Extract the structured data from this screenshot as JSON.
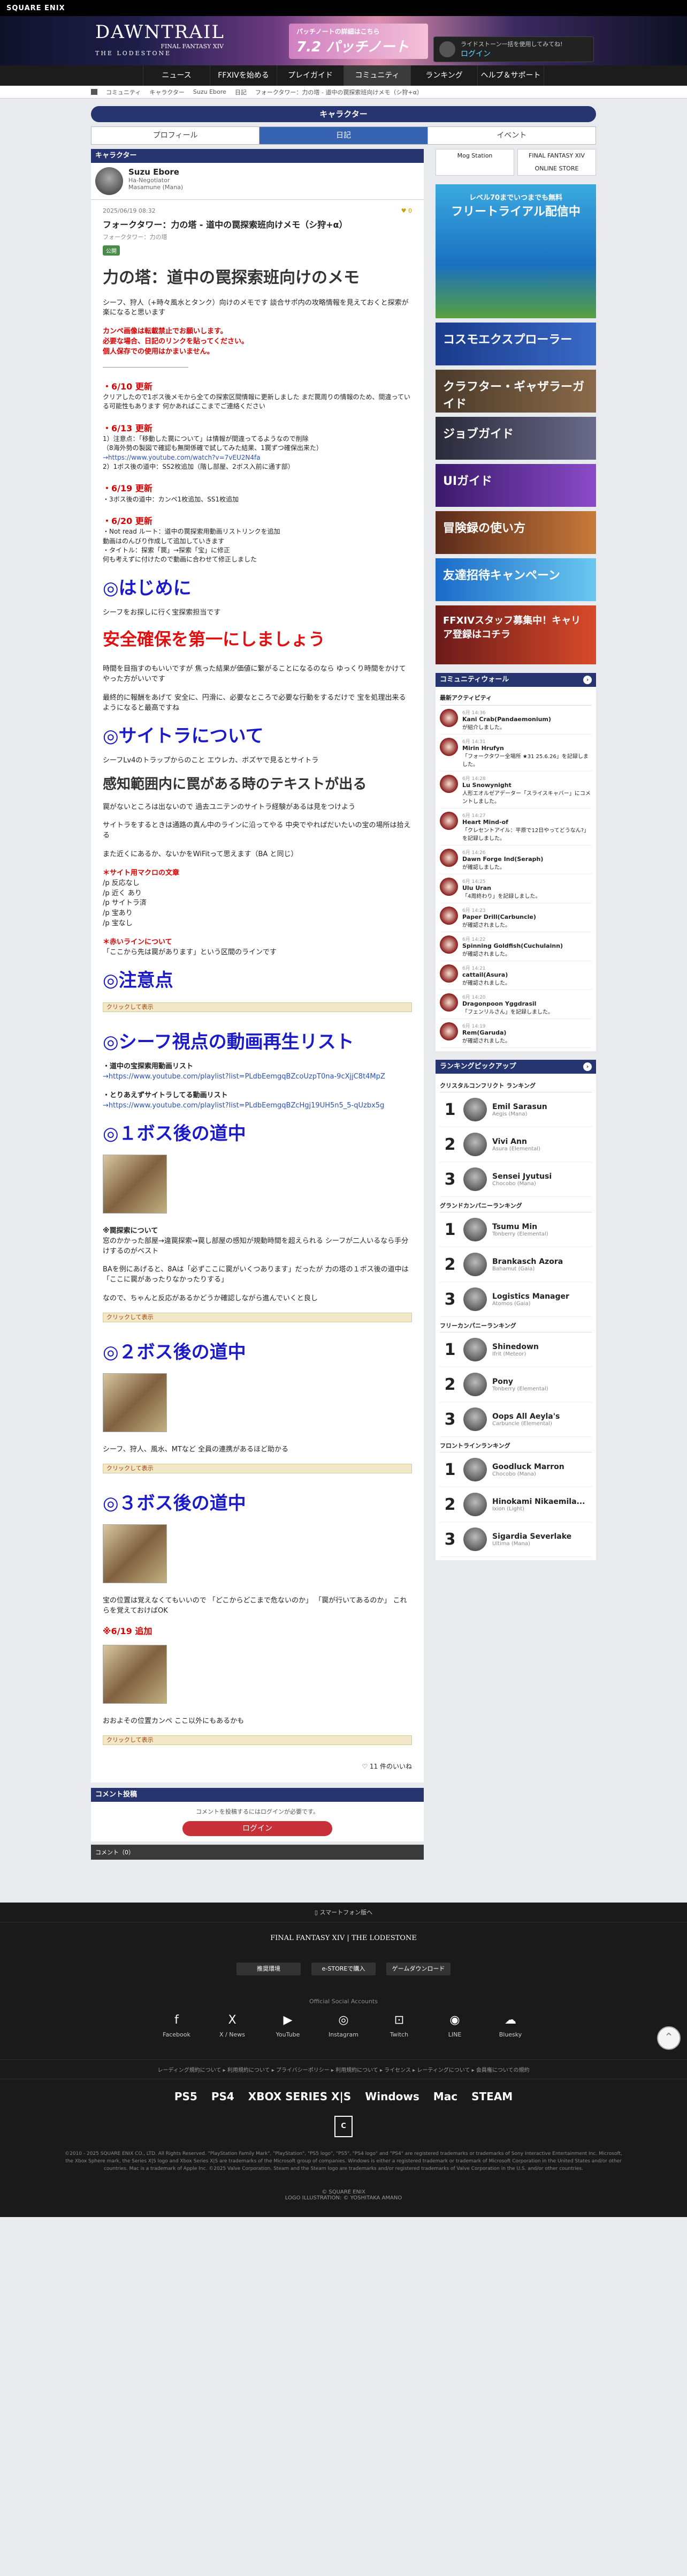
{
  "header": {
    "brand": "SQUARE ENIX",
    "logo_title": "DAWNTRAIL",
    "logo_sub": "FINAL FANTASY XIV",
    "logo_tag": "THE LODESTONE",
    "promo_title": "7.2 パッチノート",
    "promo_sub": "パッチノートの詳細はこちら",
    "login_prompt": "ライドストーン一括を使用してみてね!",
    "login_label": "ログイン"
  },
  "nav": [
    "ニュース",
    "FFXIVを始める",
    "プレイガイド",
    "コミュニティ",
    "ランキング",
    "ヘルプ＆サポート"
  ],
  "breadcrumb": [
    "コミュニティ",
    "キャラクター",
    "Suzu Ebore",
    "日記",
    "フォークタワー：力の塔 - 道中の罠探索班向けメモ（シ狩+α）"
  ],
  "page_title": "キャラクター",
  "tabs": [
    "プロフィール",
    "日記",
    "イベント"
  ],
  "character": {
    "panel_title": "キャラクター",
    "name": "Suzu Ebore",
    "title": "Ha-Negotiator",
    "world": "Masamune (Mana)"
  },
  "article": {
    "date": "2025/06/19 08:32",
    "likes_top": "0",
    "title": "フォークタワー：力の塔 - 道中の罠探索班向けメモ（シ狩+α）",
    "subtitle": "フォークタワー：力の塔",
    "tag": "公開",
    "main_heading": "力の塔：道中の罠探索班向けのメモ",
    "intro": "シーフ、狩人（+時々風水とタンク）向けのメモです 談合サポ内の攻略情報を見えておくと探索が楽になると思います",
    "warn1": "カンペ画像は転載禁止でお願いします。",
    "warn2": "必要な場合、日記のリンクを貼ってください。",
    "warn3": "個人保存での使用はかまいません。",
    "upd1_h": "・6/10 更新",
    "upd1_b": "クリアしたので1ボス後メモから全ての探索区間情報に更新しました まだ罠周りの情報のため、間違っている可能性もあります 何かあればここまでご連絡ください",
    "upd2_h": "・6/13 更新",
    "upd2_1": "1）注意点：「移動した罠について」は情報が間違ってるようなので削除",
    "upd2_1b": "（8海外勢の製図で確認も無関係確で試してみた結果、1罠ずつ確保出来た）",
    "upd2_link": "→https://www.youtube.com/watch?v=7vEU2N4fa",
    "upd2_2": "2）1ボス後の道中：SS2枚追加（階し部屋、2ボス入前に通す部）",
    "upd3_h": "・6/19 更新",
    "upd3_b": "・3ボス後の道中：カンペ1枚追加、SS1枚追加",
    "upd4_h": "・6/20 更新",
    "upd4_1": "・Not read ルート：道中の罠探索用動画リストリンクを追加",
    "upd4_1b": "動画はのんびり作成して追加していきます",
    "upd4_2": "・タイトル：探索「罠」→探索「宝」に修正",
    "upd4_2b": "何も考えずに付けたので動画に合わせて修正しました",
    "h_intro": "◎はじめに",
    "intro_p1": "シーフをお探しに行く宝探索担当です",
    "h_safety": "安全確保を第一にしましょう",
    "safety_p1": "時間を目指すのもいいですが 焦った結果が価値に繋がることになるのなら ゆっくり時間をかけてやった方がいいです",
    "safety_p2": "最終的に報酬をあげて 安全に、円滑に、必要なところで必要な行動をするだけで 宝を処理出来るようになると最高ですね",
    "h_saitora": "◎サイトラについて",
    "saitora_p1": "シーフLv4のトラップからのこと エウレカ、ボズヤで見るとサイトラ",
    "h_range": "感知範囲内に罠がある時のテキストが出る",
    "range_p1": "罠がないところは出ないので 過去ユニテンのサイトラ経験があるは見をつけよう",
    "range_p2": "サイトラをするときは通路の真ん中のラインに沿ってやる 中央でやればだいたいの宝の場所は拾える",
    "range_p3": "また近くにあるか、ないかをWiFitって思えます（BA と同じ）",
    "macro_h": "＊サイト用マクロの文章",
    "macro_1": "/p 反応なし",
    "macro_2": "/p 近く あり",
    "macro_3": "/p サイトラ済",
    "macro_4": "/p 宝あり",
    "macro_5": "/p 宝なし",
    "redline_h": "＊赤いラインについて",
    "redline_p": "「ここから先は罠があります」という区間のラインです",
    "h_caution": "◎注意点",
    "spoiler": "クリックして表示",
    "h_video": "◎シーフ視点の動画再生リスト",
    "video_1": "・道中の宝探索用動画リスト",
    "video_1_link": "→https://www.youtube.com/playlist?list=PLdbEemgqBZcoUzpT0na-9cXjjC8t4MpZ",
    "video_2": "・とりあえずサイトラしてる動画リスト",
    "video_2_link": "→https://www.youtube.com/playlist?list=PLdbEemgqBZcHgj19UH5n5_5-qUzbx5g",
    "h_boss1": "◎１ボス後の道中",
    "boss1_p1": "※罠探索について",
    "boss1_p2": "窓のかかった部屋→違罠探索→罠し部屋の感知が規動時間を超えられる シーフが二人いるなら手分けするのがベスト",
    "boss1_p3": "BAを例にあげると、8Aは「必ずここに罠がいくつあります」だったが 力の塔の１ボス後の道中は「ここに罠があったりなかったりする」",
    "boss1_p4": "なので、ちゃんと反応があるかどうか確認しながら進んでいくと良し",
    "h_boss2": "◎２ボス後の道中",
    "boss2_p1": "シーフ、狩人、風水、MTなど 全員の連携があるほど助かる",
    "h_boss3": "◎３ボス後の道中",
    "boss3_p1": "宝の位置は覚えなくてもいいので 「どこからどこまで危ないのか」 「罠が行いてあるのか」 これらを覚えておけばOK",
    "add_h": "※6/19 追加",
    "add_p": "おおよその位置カンペ ここ以外にもあるかも",
    "likes": "11 件のいいね",
    "comment_title": "コメント投稿",
    "comment_prompt": "コメントを投稿するにはログインが必要です。",
    "comment_login": "ログイン",
    "comment_count": "コメント（0）"
  },
  "sidebar": {
    "ad1": "Mog Station",
    "ad2": "FINAL FANTASY XIV ONLINE STORE",
    "ad_big_sub": "レベル70までいつまでも無料",
    "ad_big": "フリートライアル配信中",
    "banners": [
      "コスモエクスプローラー",
      "クラフター・ギャザラーガイド",
      "ジョブガイド",
      "UIガイド",
      "冒険録の使い方",
      "友達招待キャンペーン",
      "FFXIVスタッフ募集中！キャリア登録はコチラ"
    ],
    "community_title": "コミュニティウォール",
    "activity_title": "最新アクティビティ",
    "activities": [
      {
        "time": "6月 14:36",
        "name": "Kani Crab(Pandaemonium)",
        "text": "が紹介しました。"
      },
      {
        "time": "6月 14:31",
        "name": "Mirin Hrufyn",
        "text": "「フォークタワー全場所 ★31 25.6.26」を記録しました。"
      },
      {
        "time": "6月 14:28",
        "name": "Lu Snowynight",
        "text": "人形エオルゼアデーター「スライスキャバー」にコメントしました。"
      },
      {
        "time": "6月 14:27",
        "name": "Heart Mind-of",
        "text": "「クレセントアイル：平原で12日やってどうなん?」を記録しました。"
      },
      {
        "time": "6月 14:26",
        "name": "Dawn Forge Ind(Seraph)",
        "text": "が確認しました。"
      },
      {
        "time": "6月 14:25",
        "name": "Ulu Uran",
        "text": "「4周終わり」を記録しました。"
      },
      {
        "time": "6月 14:23",
        "name": "Paper Drill(Carbuncle)",
        "text": "が確認されました。"
      },
      {
        "time": "6月 14:22",
        "name": "Spinning Goldfish(Cuchulainn)",
        "text": "が確認されました。"
      },
      {
        "time": "6月 14:21",
        "name": "cattail(Asura)",
        "text": "が確認されました。"
      },
      {
        "time": "6月 14:20",
        "name": "Dragonpoon Yggdrasil",
        "text": "「フェンリルさん」を記録しました。"
      },
      {
        "time": "6月 14:19",
        "name": "Rem(Garuda)",
        "text": "が確認されました。"
      }
    ],
    "ranking_title": "ランキングピックアップ",
    "ranking_groups": [
      {
        "title": "クリスタルコンフリクト ランキング",
        "items": [
          {
            "rank": "1",
            "name": "Emil Sarasun",
            "world": "Aegis (Mana)"
          },
          {
            "rank": "2",
            "name": "Vivi Ann",
            "world": "Asura (Elemental)"
          },
          {
            "rank": "3",
            "name": "Sensei Jyutusi",
            "world": "Chocobo (Mana)"
          }
        ]
      },
      {
        "title": "グランドカンパニーランキング",
        "items": [
          {
            "rank": "1",
            "name": "Tsumu Min",
            "world": "Tonberry (Elemental)"
          },
          {
            "rank": "2",
            "name": "Brankasch Azora",
            "world": "Bahamut (Gaia)"
          },
          {
            "rank": "3",
            "name": "Logistics Manager",
            "world": "Atomos (Gaia)"
          }
        ]
      },
      {
        "title": "フリーカンパニーランキング",
        "items": [
          {
            "rank": "1",
            "name": "Shinedown",
            "world": "Ifrit (Meteor)"
          },
          {
            "rank": "2",
            "name": "Pony",
            "world": "Tonberry (Elemental)"
          },
          {
            "rank": "3",
            "name": "Oops All Aeyla's",
            "world": "Carbuncle (Elemental)"
          }
        ]
      },
      {
        "title": "フロントラインランキング",
        "items": [
          {
            "rank": "1",
            "name": "Goodluck Marron",
            "world": "Chocobo (Mana)"
          },
          {
            "rank": "2",
            "name": "Hinokami Nikaemila...",
            "world": "Ixion (Light)"
          },
          {
            "rank": "3",
            "name": "Sigardia Severlake",
            "world": "Ultima (Mana)"
          }
        ]
      }
    ]
  },
  "footer": {
    "top_link": "スマートフォン版へ",
    "logo": "FINAL FANTASY XIV | THE LODESTONE",
    "btns": [
      "推奨環境",
      "e-STOREで購入",
      "ゲームダウンロード"
    ],
    "social_heading": "Official Social Accounts",
    "social": [
      {
        "icon": "f",
        "label": "Facebook"
      },
      {
        "icon": "X",
        "label": "X / News"
      },
      {
        "icon": "▶",
        "label": "YouTube"
      },
      {
        "icon": "◎",
        "label": "Instagram"
      },
      {
        "icon": "⊡",
        "label": "Twitch"
      },
      {
        "icon": "◉",
        "label": "LINE"
      },
      {
        "icon": "☁",
        "label": "Bluesky"
      }
    ],
    "links": "レーディング規約について ▸ 利用規約について ▸ プライバシーポリシー ▸ 利用規約について ▸ ライセンス ▸ レーティングについて ▸ 会員権についての規約",
    "platforms": [
      "PS5",
      "PS4",
      "XBOX SERIES X|S",
      "Windows",
      "Mac",
      "STEAM"
    ],
    "rating": "C",
    "legal": "©2010 - 2025 SQUARE ENIX CO., LTD. All Rights Reserved. \"PlayStation Family Mark\", \"PlayStation\", \"PS5 logo\", \"PS5\", \"PS4 logo\" and \"PS4\" are registered trademarks or trademarks of Sony Interactive Entertainment Inc. Microsoft, the Xbox Sphere mark, the Series X|S logo and Xbox Series X|S are trademarks of the Microsoft group of companies. Windows is either a registered trademark or trademark of Microsoft Corporation in the United States and/or other countries. Mac is a trademark of Apple Inc. ©2025 Valve Corporation. Steam and the Steam logo are trademarks and/or registered trademarks of Valve Corporation in the U.S. and/or other countries.",
    "copyright": "© SQUARE ENIX",
    "copyright2": "LOGO ILLUSTRATION: © YOSHITAKA AMANO"
  }
}
